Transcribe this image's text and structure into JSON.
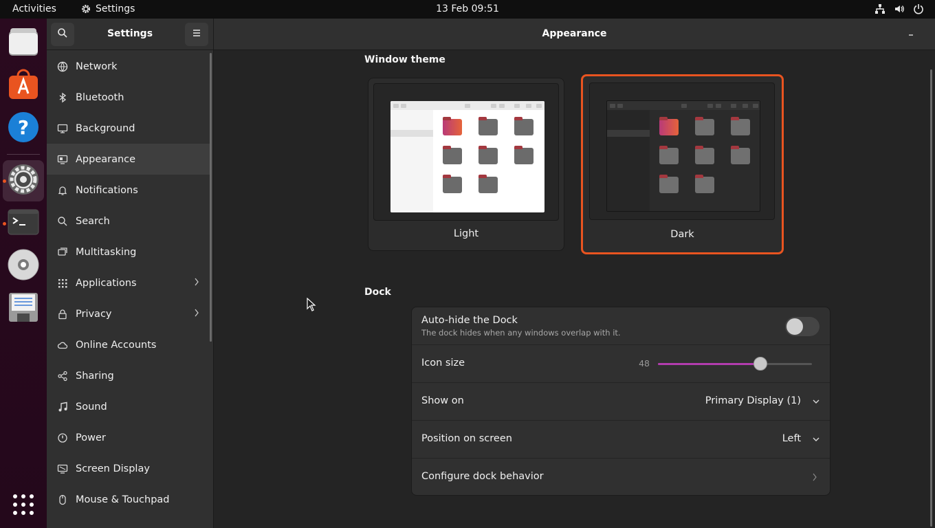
{
  "topbar": {
    "activities": "Activities",
    "app_menu": "Settings",
    "clock": "13 Feb  09:51"
  },
  "window": {
    "sidebar_title": "Settings",
    "title": "Appearance"
  },
  "sidebar": {
    "items": [
      {
        "label": "Network",
        "icon": "network-icon"
      },
      {
        "label": "Bluetooth",
        "icon": "bluetooth-icon"
      },
      {
        "label": "Background",
        "icon": "background-icon"
      },
      {
        "label": "Appearance",
        "icon": "appearance-icon",
        "selected": true
      },
      {
        "label": "Notifications",
        "icon": "bell-icon"
      },
      {
        "label": "Search",
        "icon": "search-icon"
      },
      {
        "label": "Multitasking",
        "icon": "multitasking-icon"
      },
      {
        "label": "Applications",
        "icon": "applications-icon",
        "has_submenu": true
      },
      {
        "label": "Privacy",
        "icon": "lock-icon",
        "has_submenu": true
      },
      {
        "label": "Online Accounts",
        "icon": "cloud-icon"
      },
      {
        "label": "Sharing",
        "icon": "share-icon"
      },
      {
        "label": "Sound",
        "icon": "music-note-icon"
      },
      {
        "label": "Power",
        "icon": "power-icon"
      },
      {
        "label": "Screen Display",
        "icon": "display-icon"
      },
      {
        "label": "Mouse & Touchpad",
        "icon": "mouse-icon"
      }
    ]
  },
  "window_theme": {
    "heading": "Window theme",
    "options": [
      {
        "label": "Light",
        "selected": false
      },
      {
        "label": "Dark",
        "selected": true
      }
    ],
    "accent_color": "#e95420"
  },
  "dock": {
    "heading": "Dock",
    "autohide": {
      "title": "Auto-hide the Dock",
      "subtitle": "The dock hides when any windows overlap with it.",
      "enabled": false
    },
    "icon_size": {
      "title": "Icon size",
      "value": "48",
      "min": 16,
      "max": 64,
      "current": 48
    },
    "show_on": {
      "title": "Show on",
      "value": "Primary Display (1)"
    },
    "position": {
      "title": "Position on screen",
      "value": "Left"
    },
    "configure": {
      "title": "Configure dock behavior"
    }
  }
}
